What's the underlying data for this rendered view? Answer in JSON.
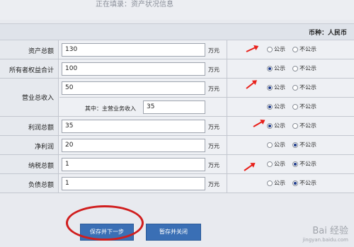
{
  "header": {
    "title": "正在填录：资产状况信息"
  },
  "currency": "币种：人民币",
  "colors": {
    "accent": "#3a6fb5",
    "annotation": "#e8201a"
  },
  "rows": [
    {
      "label": "资产总额",
      "value": "130",
      "unit": "万元",
      "public": "公示",
      "private": "不公示",
      "selected": "public"
    },
    {
      "label": "所有者权益合计",
      "value": "100",
      "unit": "万元",
      "public": "公示",
      "private": "不公示",
      "selected": "public"
    },
    {
      "label": "营业总收入",
      "value": "50",
      "unit": "万元",
      "public": "公示",
      "private": "不公示",
      "selected": "public"
    },
    {
      "sub_label": "其中：主营业务收入",
      "value": "35",
      "public": "公示",
      "private": "不公示",
      "selected": "public"
    },
    {
      "label": "利润总额",
      "value": "35",
      "unit": "万元",
      "public": "公示",
      "private": "不公示",
      "selected": "public"
    },
    {
      "label": "净利润",
      "value": "20",
      "unit": "万元",
      "public": "公示",
      "private": "不公示",
      "selected": "private"
    },
    {
      "label": "纳税总额",
      "value": "1",
      "unit": "万元",
      "public": "公示",
      "private": "不公示",
      "selected": "private"
    },
    {
      "label": "负债总额",
      "value": "1",
      "unit": "万元",
      "public": "公示",
      "private": "不公示",
      "selected": "private"
    }
  ],
  "buttons": {
    "save_next": "保存并下一步",
    "save_close": "暂存并关闭"
  },
  "watermark": {
    "brand": "Bai 经验",
    "url": "jingyan.baidu.com"
  }
}
